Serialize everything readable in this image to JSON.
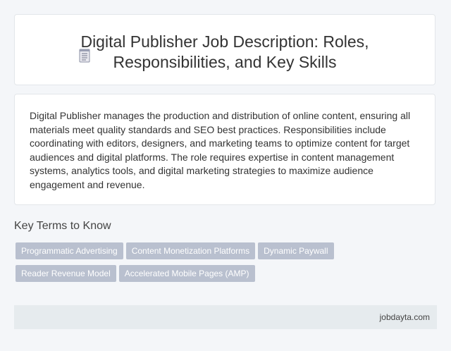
{
  "header": {
    "icon": "document-icon",
    "title": "Digital Publisher Job Description: Roles, Responsibilities, and Key Skills"
  },
  "description": "Digital Publisher manages the production and distribution of online content, ensuring all materials meet quality standards and SEO best practices. Responsibilities include coordinating with editors, designers, and marketing teams to optimize content for target audiences and digital platforms. The role requires expertise in content management systems, analytics tools, and digital marketing strategies to maximize audience engagement and revenue.",
  "key_terms": {
    "heading": "Key Terms to Know",
    "tags": [
      "Programmatic Advertising",
      "Content Monetization Platforms",
      "Dynamic Paywall",
      "Reader Revenue Model",
      "Accelerated Mobile Pages (AMP)"
    ]
  },
  "footer": {
    "site": "jobdayta.com"
  },
  "colors": {
    "tag_background": "#b9c0cf",
    "footer_background": "#e6ebee",
    "page_background": "#f4f6f9"
  }
}
